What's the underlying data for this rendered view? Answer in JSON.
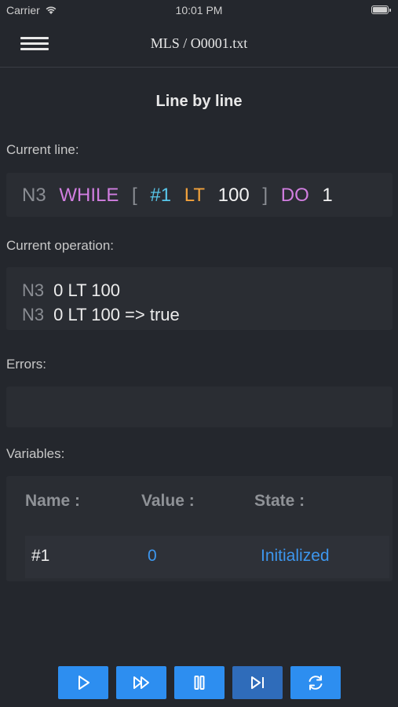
{
  "status": {
    "carrier": "Carrier",
    "time": "10:01 PM"
  },
  "nav": {
    "title": "MLS / O0001.txt"
  },
  "page_title": "Line by line",
  "current_line": {
    "label": "Current line:",
    "tokens": [
      "N3",
      "WHILE",
      "[",
      "#1",
      "LT",
      "100",
      "]",
      "DO",
      "1"
    ]
  },
  "current_operation": {
    "label": "Current operation:",
    "lines": [
      {
        "n": "N3",
        "text": "0 LT 100"
      },
      {
        "n": "N3",
        "text": "0 LT 100 => true"
      }
    ]
  },
  "errors": {
    "label": "Errors:"
  },
  "variables": {
    "label": "Variables:",
    "headers": [
      "Name :",
      "Value :",
      "State :"
    ],
    "rows": [
      {
        "name": "#1",
        "value": "0",
        "state": "Initialized"
      }
    ]
  },
  "colors": {
    "accent": "#2d8ef0",
    "keyword": "#d17ee0",
    "variable": "#58c6ea",
    "operator": "#f2a23c"
  },
  "controls": [
    "play-icon",
    "fast-forward-icon",
    "pause-icon",
    "step-forward-icon",
    "reload-icon"
  ]
}
